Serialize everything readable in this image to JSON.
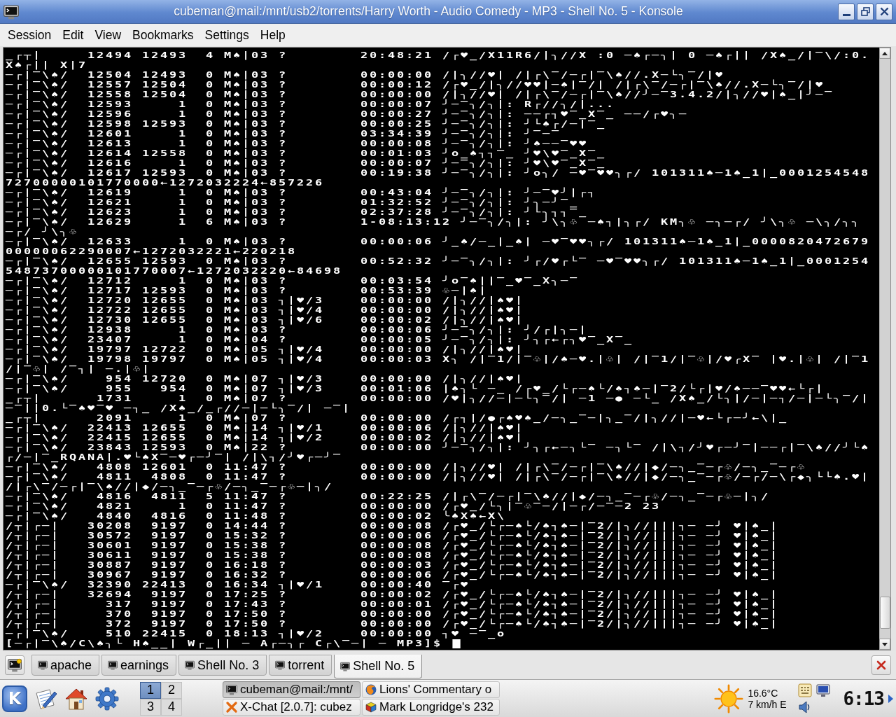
{
  "window": {
    "title": "cubeman@mail:/mnt/usb2/torrents/Harry Worth - Audio Comedy - MP3 - Shell No. 5 - Konsole"
  },
  "menu": [
    "Session",
    "Edit",
    "View",
    "Bookmarks",
    "Settings",
    "Help"
  ],
  "terminal": {
    "rows": [
      {
        "kind": "process",
        "uid": "_┌┬|",
        "pid": "12494",
        "ppid": "12493",
        "c": "4",
        "stime": "M♠|03",
        "tty": "?",
        "time": "20:48:21",
        "cmd": "/┌♥_/X11R6/|╮//X :0 ─♠┌─╮| 0 ─♠┌|| /X♠_/|‾\\/:0."
      },
      {
        "kind": "text",
        "text": "X♠┌|| X|7"
      },
      {
        "kind": "process",
        "uid": "─┌|‾\\♠/",
        "pid": "12504",
        "ppid": "12493",
        "c": "0",
        "stime": "M♠|03",
        "tty": "?",
        "time": "00:00:00",
        "cmd": "/|╮//♥| /|┌\\‾/─┌|‾\\♠//.X─└╮‾/|♥"
      },
      {
        "kind": "process",
        "uid": "─┌|‾\\♠/",
        "pid": "12557",
        "ppid": "12504",
        "c": "0",
        "stime": "M♠|03",
        "tty": "?",
        "time": "00:00:12",
        "cmd": "/┌♥_/|╮//♥♥|─♠|‾/| /|┌\\‾/─┌|‾\\♠//.X─└╮‾/|♥"
      },
      {
        "kind": "process",
        "uid": "─┌|‾\\♠/",
        "pid": "12558",
        "ppid": "12504",
        "c": "0",
        "stime": "M♠|03",
        "tty": "?",
        "time": "00:00:00",
        "cmd": "/|╮//♥| /|┌\\‾/─┌|‾\\♠//╯─‾3.4.2/|╮//♥|♠_|╯─‾"
      },
      {
        "kind": "process",
        "uid": "─┌|‾\\♠/",
        "pid": "12593",
        "ppid": "1",
        "c": "0",
        "stime": "M♠|03",
        "tty": "?",
        "time": "00:00:07",
        "cmd": "╯─‾╮/╮|: R┌//╮/|..."
      },
      {
        "kind": "process",
        "uid": "─┌|‾\\♠/",
        "pid": "12596",
        "ppid": "1",
        "c": "0",
        "stime": "M♠|03",
        "tty": "?",
        "time": "00:00:27",
        "cmd": "╯─‾╮/╮|: ──┌┐♥‾_X‾_ ──/┌♥╮─"
      },
      {
        "kind": "process",
        "uid": "─┌|‾\\♠/",
        "pid": "12598",
        "ppid": "12593",
        "c": "0",
        "stime": "M♠|03",
        "tty": "?",
        "time": "00:00:25",
        "cmd": "╯─‾╮/╮|: ╯└♠┌/─|‾_"
      },
      {
        "kind": "process",
        "uid": "─┌|‾\\♠/",
        "pid": "12601",
        "ppid": "1",
        "c": "0",
        "stime": "M♠|03",
        "tty": "?",
        "time": "03:34:39",
        "cmd": "╯─‾╮/╮|: ╯‾─‾"
      },
      {
        "kind": "process",
        "uid": "─┌|‾\\♠/",
        "pid": "12613",
        "ppid": "1",
        "c": "0",
        "stime": "M♠|03",
        "tty": "?",
        "time": "00:00:08",
        "cmd": "╯─‾╮/╮|: ╯♠──‾♥♥"
      },
      {
        "kind": "process",
        "uid": "─┌|‾\\♠/",
        "pid": "12614",
        "ppid": "12558",
        "c": "0",
        "stime": "M♠|03",
        "tty": "?",
        "time": "00:01:03",
        "cmd": "╯o_♠┐┐‾_ ╯♥\\♥‾_X‾_"
      },
      {
        "kind": "process",
        "uid": "─┌|‾\\♠/",
        "pid": "12616",
        "ppid": "1",
        "c": "0",
        "stime": "M♠|03",
        "tty": "?",
        "time": "00:00:07",
        "cmd": "╯─‾╮/╮|: ╯♥\\♥‾_X‾_"
      },
      {
        "kind": "process",
        "uid": "─┌|‾\\♠/",
        "pid": "12617",
        "ppid": "12593",
        "c": "0",
        "stime": "M♠|03",
        "tty": "?",
        "time": "00:19:38",
        "cmd": "╯─‾╮/╮|: ╯o╮/ ─♥‾♥♥╮┌/ 101311♠─1♠_1|_0001254548"
      },
      {
        "kind": "text",
        "text": "72700000101770000←1272032224←857226"
      },
      {
        "kind": "process",
        "uid": "─┌|‾\\♠/",
        "pid": "12619",
        "ppid": "1",
        "c": "0",
        "stime": "M♠|03",
        "tty": "?",
        "time": "00:43:04",
        "cmd": "╯─‾╮/╮|: ╯─‾♥╯|┌┐"
      },
      {
        "kind": "process",
        "uid": "─┌|‾\\♠/",
        "pid": "12621",
        "ppid": "1",
        "c": "0",
        "stime": "M♠|03",
        "tty": "?",
        "time": "01:32:52",
        "cmd": "╯─‾╮/╮|: ╯╮─╯‾_"
      },
      {
        "kind": "process",
        "uid": "─┌|‾\\♠/",
        "pid": "12623",
        "ppid": "1",
        "c": "0",
        "stime": "M♠|03",
        "tty": "?",
        "time": "02:37:28",
        "cmd": "╯─‾╮/╮|: ╯└╮┐┐‾_"
      },
      {
        "kind": "process",
        "uid": "─┌|‾\\♠/",
        "pid": "12629",
        "ppid": "1",
        "c": "6",
        "stime": "M♠|03",
        "tty": "?",
        "time": "1-08:13:12",
        "cmd": "╯─‾╮/╮|: ╯\\╮♧ ─♠┐|╮┌/ KM╮♧ ─╮─┌/ ╯\\╮♧ ─\\╮/╮╮"
      },
      {
        "kind": "text",
        "text": "─┌/ ╯\\╮♧"
      },
      {
        "kind": "process",
        "uid": "─┌|‾\\♠/",
        "pid": "12633",
        "ppid": "1",
        "c": "0",
        "stime": "M♠|03",
        "tty": "?",
        "time": "00:00:06",
        "cmd": "╯_♠/─_|_♠| ─♥‾♥♥╮┌/ 101311♠─1♠_1|_0000820472679"
      },
      {
        "kind": "text",
        "text": "00000062290007←1272032221←220218"
      },
      {
        "kind": "process",
        "uid": "─┌|‾\\♠/",
        "pid": "12655",
        "ppid": "12593",
        "c": "0",
        "stime": "M♠|03",
        "tty": "?",
        "time": "00:52:32",
        "cmd": "╯─‾╮/╮|: ╯┌/♥┌└‾ ─♥‾♥♥╮┌/ 101311♠─1♠_1|_0001254"
      },
      {
        "kind": "text",
        "text": "54873700000101770007←1272032220←84698"
      },
      {
        "kind": "process",
        "uid": "─┌|‾\\♠/",
        "pid": "12712",
        "ppid": "1",
        "c": "0",
        "stime": "M♠|03",
        "tty": "?",
        "time": "00:03:54",
        "cmd": "╯o‾♠||‾_♥‾_X╮─‾"
      },
      {
        "kind": "process",
        "uid": "─┌|‾\\♠/",
        "pid": "12717",
        "ppid": "12593",
        "c": "0",
        "stime": "M♠|03",
        "tty": "?",
        "time": "00:53:39",
        "cmd": "♧─|♠|"
      },
      {
        "kind": "process",
        "uid": "─┌|‾\\♠/",
        "pid": "12720",
        "ppid": "12655",
        "c": "0",
        "stime": "M♠|03",
        "tty": "┐|♥/3",
        "time": "00:00:00",
        "cmd": "/|╮//|♠♥|"
      },
      {
        "kind": "process",
        "uid": "─┌|‾\\♠/",
        "pid": "12722",
        "ppid": "12655",
        "c": "0",
        "stime": "M♠|03",
        "tty": "┐|♥/4",
        "time": "00:00:00",
        "cmd": "/|╮//|♠♥|"
      },
      {
        "kind": "process",
        "uid": "─┌|‾\\♠/",
        "pid": "12730",
        "ppid": "12655",
        "c": "0",
        "stime": "M♠|03",
        "tty": "┐|♥/6",
        "time": "00:00:02",
        "cmd": "/|╮//|♠♥|"
      },
      {
        "kind": "process",
        "uid": "─┌|‾\\♠/",
        "pid": "12938",
        "ppid": "1",
        "c": "0",
        "stime": "M♠|03",
        "tty": "?",
        "time": "00:00:06",
        "cmd": "╯─‾╮/╮|: ╯/┌|╮─|"
      },
      {
        "kind": "process",
        "uid": "─┌|‾\\♠/",
        "pid": "23407",
        "ppid": "1",
        "c": "0",
        "stime": "M♠|04",
        "tty": "?",
        "time": "00:00:05",
        "cmd": "╯─‾╮/╮|: ╯╮┌←┌╮♥‾_X‾_"
      },
      {
        "kind": "process",
        "uid": "─┌|‾\\♠/",
        "pid": "19797",
        "ppid": "12722",
        "c": "0",
        "stime": "M♠|05",
        "tty": "┐|♥/4",
        "time": "00:00:00",
        "cmd": "/|╮//|♠♥|"
      },
      {
        "kind": "process",
        "uid": "─┌|‾\\♠/",
        "pid": "19798",
        "ppid": "19797",
        "c": "0",
        "stime": "M♠|05",
        "tty": "┐|♥/4",
        "time": "00:00:03",
        "cmd": "X╮ /|‾1/|‾♧|/♠─♥.|♧| /|‾1/|‾♧|/♥╭X‾ |♥.|♧| /|‾1"
      },
      {
        "kind": "text",
        "text": "/|‾♧| /‾┐| ─.|♧|"
      },
      {
        "kind": "process",
        "uid": "─┌|‾\\♠/",
        "pid": "954",
        "ppid": "12720",
        "c": "0",
        "stime": "M♠|07",
        "tty": "┐|♥/3",
        "time": "00:00:00",
        "cmd": "/|╮//|♠♥|"
      },
      {
        "kind": "process",
        "uid": "─┌|‾\\♠/",
        "pid": "955",
        "ppid": "954",
        "c": "0",
        "stime": "M♠|07",
        "tty": "┐|♥/3",
        "time": "00:01:06",
        "cmd": "|♠╮└ ─_ /┌♥_/└┌─♠└/♠┐♠─|‾2/└┌|♥/♠──‾♥♥←└┌|"
      },
      {
        "kind": "process",
        "uid": "_┌┬|",
        "pid": "1731",
        "ppid": "1",
        "c": "0",
        "stime": "M♠|07",
        "tty": "?",
        "time": "00:00:00",
        "cmd": "/♥|╮//─|─└╮‾/| ─1 ─● ─└_ /X♠_/└╮|/─|─┐/─|─└╮‾/|"
      },
      {
        "kind": "text",
        "text": "─‾||0.└‾♠♥‾♥ ─┐_ /X♠_/_┌//─|─└╮‾/| ─‾|"
      },
      {
        "kind": "process",
        "uid": "_┌┬|",
        "pid": "2091",
        "ppid": "1",
        "c": "0",
        "stime": "M♠|07",
        "tty": "?",
        "time": "00:00:00",
        "cmd": "/┌┐|/●┌♠♥♠_/─╮_‾─|╮_‾/|╮//|─♥←└┌─╯←\\|_"
      },
      {
        "kind": "process",
        "uid": "─┌|‾\\♠/",
        "pid": "22413",
        "ppid": "12655",
        "c": "0",
        "stime": "M♠|14",
        "tty": "┐|♥/1",
        "time": "00:00:06",
        "cmd": "/|╮//|♠♥|"
      },
      {
        "kind": "process",
        "uid": "─┌|‾\\♠/",
        "pid": "22415",
        "ppid": "12655",
        "c": "0",
        "stime": "M♠|14",
        "tty": "┐|♥/2",
        "time": "00:00:02",
        "cmd": "/|╮//|♠♥|"
      },
      {
        "kind": "process",
        "uid": "─┌|‾\\♠/",
        "pid": "23843",
        "ppid": "12593",
        "c": "0",
        "stime": "M♠|22",
        "tty": "?",
        "time": "00:00:00",
        "cmd": "╯─‾╮/╮|: ╯╮┌←─╮└‾ ─╮└‾ /|\\┐/╯♥┌─╯‾|──┌|‾\\♠//╯└♠"
      },
      {
        "kind": "text",
        "text": "┌/─|‾_RQANA|.♥└♠X‾─♥┌─╯‾| /|\\┐/╯♥┌─╯‾"
      },
      {
        "kind": "process",
        "uid": "─┌|‾\\♠/",
        "pid": "4808",
        "ppid": "12601",
        "c": "0",
        "stime": "11:47",
        "tty": "?",
        "time": "00:00:00",
        "cmd": "/|╮//♥| /|┌\\‾/─┌|‾\\♠//|◆/─╮_‾─┌♧/─╮_‾─┌♧"
      },
      {
        "kind": "process",
        "uid": "─┌|‾\\♠/",
        "pid": "4811",
        "ppid": "4808",
        "c": "0",
        "stime": "11:47",
        "tty": "?",
        "time": "00:00:00",
        "cmd": "/|╮//♥| /|┌\\‾/─┌|‾\\♠//|◆/─╮_‾─┌♧/─┌/─\\┌◆╮└└♠.♥|"
      },
      {
        "kind": "text",
        "text": "/|┌\\‾/─┌|‾\\♠//|◆/─╮_‾─┌♧/─╮_‾─┌♧─|╮/"
      },
      {
        "kind": "process",
        "uid": "─┌|‾\\♠/",
        "pid": "4816",
        "ppid": "4811",
        "c": "5",
        "stime": "11:47",
        "tty": "?",
        "time": "00:22:25",
        "cmd": "/|┌\\‾/─┌|‾\\♠//|◆/─╮_‾─┌♧/─╮_‾─┌♧─|╮/"
      },
      {
        "kind": "process",
        "uid": "─┌|‾\\♠/",
        "pid": "4821",
        "ppid": "1",
        "c": "0",
        "stime": "11:47",
        "tty": "?",
        "time": "00:00:00",
        "cmd": "/┌♥_/└╮|‾♧‾─/|─┌/─‾─2 23"
      },
      {
        "kind": "process",
        "uid": "─┌|‾\\♠/",
        "pid": "4840",
        "ppid": "4816",
        "c": "0",
        "stime": "11:48",
        "tty": "?",
        "time": "00:00:02",
        "cmd": "╰♠X♠←X\\"
      },
      {
        "kind": "process",
        "uid": "/┬|┌─|",
        "pid": "30208",
        "ppid": "9197",
        "c": "0",
        "stime": "14:44",
        "tty": "?",
        "time": "00:00:08",
        "cmd": "/┌♥_/└┌─♠└/♠┐♠─|‾2/|╮//|||┐─ ─╯ ♥|♠_|"
      },
      {
        "kind": "process",
        "uid": "/┬|┌─|",
        "pid": "30572",
        "ppid": "9197",
        "c": "0",
        "stime": "15:32",
        "tty": "?",
        "time": "00:00:06",
        "cmd": "/┌♥_/└┌─♠└/♠┐♠─|‾2/|╮//|||┐─ ─╯ ♥|♠_|"
      },
      {
        "kind": "process",
        "uid": "/┬|┌─|",
        "pid": "30601",
        "ppid": "9197",
        "c": "0",
        "stime": "15:38",
        "tty": "?",
        "time": "00:00:08",
        "cmd": "/┌♥_/└┌─♠└/♠┐♠─|‾2/|╮//|||┐─ ─╯ ♥|♠_|"
      },
      {
        "kind": "process",
        "uid": "/┬|┌─|",
        "pid": "30611",
        "ppid": "9197",
        "c": "0",
        "stime": "15:38",
        "tty": "?",
        "time": "00:00:08",
        "cmd": "/┌♥_/└┌─♠└/♠┐♠─|‾2/|╮//|||┐─ ─╯ ♥|♠_|"
      },
      {
        "kind": "process",
        "uid": "/┬|┌─|",
        "pid": "30887",
        "ppid": "9197",
        "c": "0",
        "stime": "16:18",
        "tty": "?",
        "time": "00:00:03",
        "cmd": "/┌♥_/└┌─♠└/♠┐♠─|‾2/|╮//|||┐─ ─╯ ♥|♠_|"
      },
      {
        "kind": "process",
        "uid": "/┬|┌─|",
        "pid": "30967",
        "ppid": "9197",
        "c": "0",
        "stime": "16:32",
        "tty": "?",
        "time": "00:00:06",
        "cmd": "/┌♥_/└┌─♠└/♠┐♠─|‾2/|╮//|||┐─ ─╯ ♥|♠_|"
      },
      {
        "kind": "process",
        "uid": "─┌|‾\\♠/",
        "pid": "32390",
        "ppid": "22413",
        "c": "0",
        "stime": "16:34",
        "tty": "┐|♥/1",
        "time": "00:00:40",
        "cmd": "‾┌♥"
      },
      {
        "kind": "process",
        "uid": "/┬|┌─|",
        "pid": "32694",
        "ppid": "9197",
        "c": "0",
        "stime": "17:25",
        "tty": "?",
        "time": "00:00:02",
        "cmd": "/┌♥_/└┌─♠└/♠┐♠─|‾2/|╮//|||┐─ ─╯ ♥|♠_|"
      },
      {
        "kind": "process",
        "uid": "/┬|┌─|",
        "pid": "317",
        "ppid": "9197",
        "c": "0",
        "stime": "17:43",
        "tty": "?",
        "time": "00:00:01",
        "cmd": "/┌♥_/└┌─♠└/♠┐♠─|‾2/|╮//|||┐─ ─╯ ♥|♠_|"
      },
      {
        "kind": "process",
        "uid": "/┬|┌─|",
        "pid": "370",
        "ppid": "9197",
        "c": "0",
        "stime": "17:50",
        "tty": "?",
        "time": "00:00:00",
        "cmd": "/┌♥_/└┌─♠└/♠┐♠─|‾2/|╮//|||┐─ ─╯ ♥|♠_|"
      },
      {
        "kind": "process",
        "uid": "/┬|┌─|",
        "pid": "372",
        "ppid": "9197",
        "c": "0",
        "stime": "17:50",
        "tty": "?",
        "time": "00:00:00",
        "cmd": "/┌♥_/└┌─♠└/♠┐♠─|‾2/|╮//|||┐─ ─╯ ♥|♠_|"
      },
      {
        "kind": "process",
        "uid": "─┌|‾\\♠/",
        "pid": "510",
        "ppid": "22415",
        "c": "0",
        "stime": "18:13",
        "tty": "┐|♥/2",
        "time": "00:00:00",
        "cmd": "┐♥ ─‾_o"
      },
      {
        "kind": "prompt",
        "text": "[─┌|‾\\♠/C\\♠╮└ H♠__| W┌_|| ─ A┌─╮┌ C┌\\‾─| ─ MP3]$"
      }
    ]
  },
  "tabs": [
    {
      "label": "apache",
      "selected": false
    },
    {
      "label": "earnings",
      "selected": false
    },
    {
      "label": "Shell No. 3",
      "selected": false
    },
    {
      "label": "torrent",
      "selected": false
    },
    {
      "label": "Shell No. 5",
      "selected": true
    }
  ],
  "panel": {
    "start_button": "K",
    "desktops": [
      {
        "label": "1",
        "selected": true
      },
      {
        "label": "2",
        "selected": false
      },
      {
        "label": "3",
        "selected": false
      },
      {
        "label": "4",
        "selected": false
      }
    ],
    "tasks": [
      {
        "kind": "terminal",
        "label": "cubeman@mail:/mnt/",
        "selected": true
      },
      {
        "kind": "browser",
        "label": "Lions' Commentary o",
        "selected": false
      },
      {
        "kind": "chat",
        "label": "X-Chat [2.0.7]: cubez",
        "selected": false
      },
      {
        "kind": "puzzle",
        "label": "Mark Longridge's 232",
        "selected": false
      }
    ],
    "weather": {
      "temperature": "16.6°C",
      "wind": "7 km/h E"
    },
    "clock": "6:13"
  }
}
